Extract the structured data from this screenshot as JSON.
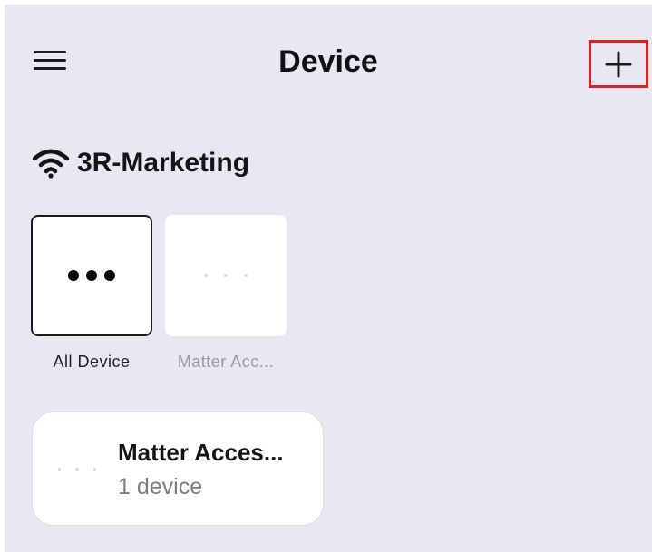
{
  "header": {
    "title": "Device",
    "menu_icon": "hamburger-menu-icon",
    "add_icon": "plus-icon",
    "highlight_color": "#e02020"
  },
  "network": {
    "icon": "wifi-icon",
    "name": "3R-Marketing"
  },
  "categories": [
    {
      "label": "All Device",
      "icon": "more-dots-icon",
      "selected": true
    },
    {
      "label": "Matter Acc...",
      "icon": "placeholder-dots-icon",
      "selected": false
    }
  ],
  "groups": [
    {
      "name": "Matter Acces...",
      "count_text": "1 device",
      "icon": "placeholder-dots-icon"
    }
  ],
  "colors": {
    "background": "#e9e7f2",
    "card": "#ffffff",
    "text_primary": "#111111",
    "text_secondary": "#7c7c83"
  }
}
